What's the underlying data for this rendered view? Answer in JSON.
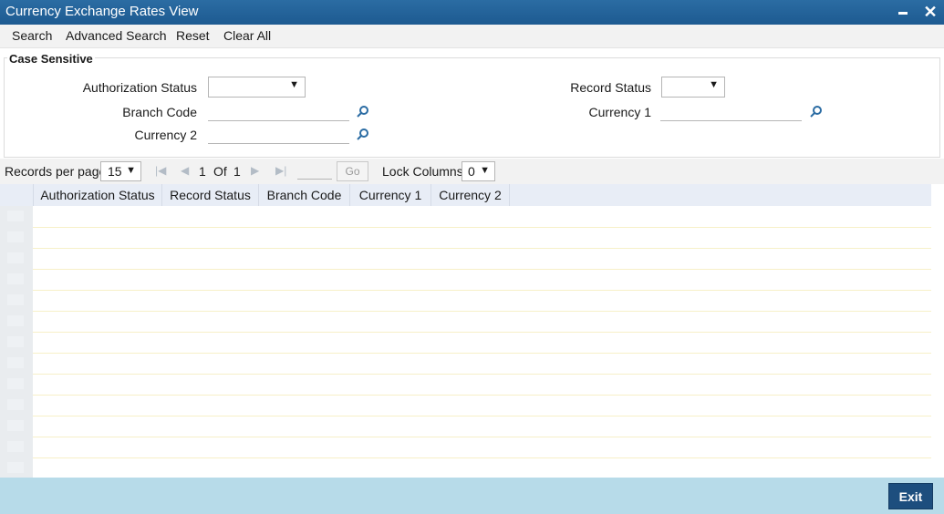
{
  "window": {
    "title": "Currency Exchange Rates View"
  },
  "toolbar": {
    "search": "Search",
    "advanced_search": "Advanced Search",
    "reset": "Reset",
    "clear_all": "Clear All"
  },
  "panel": {
    "legend": "Case Sensitive",
    "authorization_status_label": "Authorization Status",
    "authorization_status_value": "",
    "record_status_label": "Record Status",
    "record_status_value": "",
    "branch_code_label": "Branch Code",
    "branch_code_value": "",
    "currency1_label": "Currency 1",
    "currency1_value": "",
    "currency2_label": "Currency 2",
    "currency2_value": ""
  },
  "pager": {
    "records_per_page_label": "Records per page",
    "records_per_page_value": "15",
    "current_page": "1",
    "of_label": "Of",
    "total_pages": "1",
    "go_label": "Go",
    "lock_columns_label": "Lock Columns",
    "lock_columns_value": "0"
  },
  "grid": {
    "columns": [
      "Authorization Status",
      "Record Status",
      "Branch Code",
      "Currency 1",
      "Currency 2"
    ],
    "row_count": 13
  },
  "footer": {
    "exit_label": "Exit"
  },
  "icons": {
    "dropdown": "chevron-down-icon",
    "lookup": "search-icon",
    "first": "first-page-icon",
    "prev": "prev-page-icon",
    "next": "next-page-icon",
    "last": "last-page-icon"
  },
  "colors": {
    "titlebar": "#1d5a91",
    "footer": "#b7dbe9",
    "exit_button": "#1d4e7e",
    "grid_header": "#e8edf6"
  }
}
